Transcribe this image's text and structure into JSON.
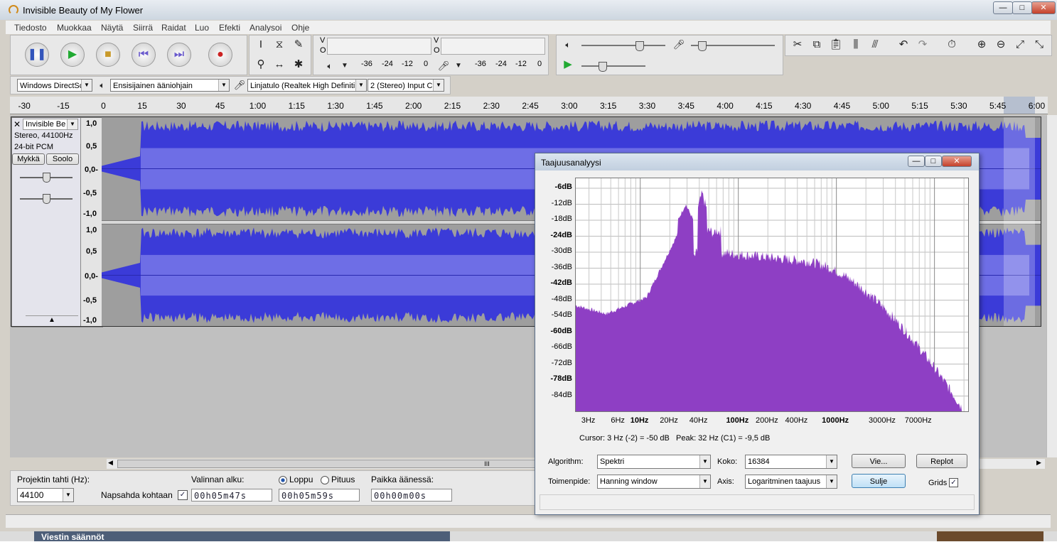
{
  "app": {
    "title": "Invisible Beauty of My Flower"
  },
  "menu": [
    "Tiedosto",
    "Muokkaa",
    "Näytä",
    "Siirrä",
    "Raidat",
    "Luo",
    "Efekti",
    "Analysoi",
    "Ohje"
  ],
  "meters": {
    "play_ticks": [
      "-36",
      "-24",
      "-12",
      "0"
    ],
    "rec_ticks": [
      "-36",
      "-24",
      "-12",
      "0"
    ],
    "v_letter": "V",
    "o_letter": "O"
  },
  "devices": {
    "host": "Windows DirectSc",
    "output": "Ensisijainen ääniohjain",
    "input": "Linjatulo (Realtek High Definiti",
    "channels": "2 (Stereo) Input C"
  },
  "ruler": [
    "-30",
    "-15",
    "0",
    "15",
    "30",
    "45",
    "1:00",
    "1:15",
    "1:30",
    "1:45",
    "2:00",
    "2:15",
    "2:30",
    "2:45",
    "3:00",
    "3:15",
    "3:30",
    "3:45",
    "4:00",
    "4:15",
    "4:30",
    "4:45",
    "5:00",
    "5:15",
    "5:30",
    "5:45",
    "6:00"
  ],
  "track": {
    "name": "Invisible Be",
    "info1": "Stereo, 44100Hz",
    "info2": "24-bit PCM",
    "mute": "Mykkä",
    "solo": "Soolo",
    "scale": [
      "1,0",
      "0,5",
      "0,0-",
      "-0,5",
      "-1,0"
    ]
  },
  "bottom": {
    "rate_label": "Projektin tahti (Hz):",
    "rate_value": "44100",
    "snap_label": "Napsahda kohtaan",
    "sel_start_label": "Valinnan alku:",
    "end_label": "Loppu",
    "length_label": "Pituus",
    "position_label": "Paikka äänessä:",
    "sel_start": "00h05m47s",
    "sel_end": "00h05m59s",
    "position": "00h00m00s"
  },
  "dialog": {
    "title": "Taajuusanalyysi",
    "y_labels": [
      "-6dB",
      "-12dB",
      "-18dB",
      "-24dB",
      "-30dB",
      "-36dB",
      "-42dB",
      "-48dB",
      "-54dB",
      "-60dB",
      "-66dB",
      "-72dB",
      "-78dB",
      "-84dB"
    ],
    "x_labels": [
      "3Hz",
      "6Hz",
      "10Hz",
      "20Hz",
      "40Hz",
      "100Hz",
      "200Hz",
      "400Hz",
      "1000Hz",
      "3000Hz",
      "7000Hz"
    ],
    "cursor_text": "Cursor: 3 Hz (-2) = -50 dB",
    "peak_text": "Peak: 32 Hz (C1) = -9,5 dB",
    "algorithm_label": "Algorithm:",
    "algorithm_value": "Spektri",
    "size_label": "Koko:",
    "size_value": "16384",
    "function_label": "Toimenpide:",
    "function_value": "Hanning window",
    "axis_label": "Axis:",
    "axis_value": "Logaritminen taajuus",
    "export_btn": "Vie...",
    "replot_btn": "Replot",
    "close_btn": "Sulje",
    "grids_label": "Grids",
    "fill_color": "#8e3fc4"
  },
  "behind": {
    "text": "Viestin säännöt"
  },
  "colors": {
    "wave": "#3b3bd8",
    "wave_bg": "#9e9e9e"
  }
}
